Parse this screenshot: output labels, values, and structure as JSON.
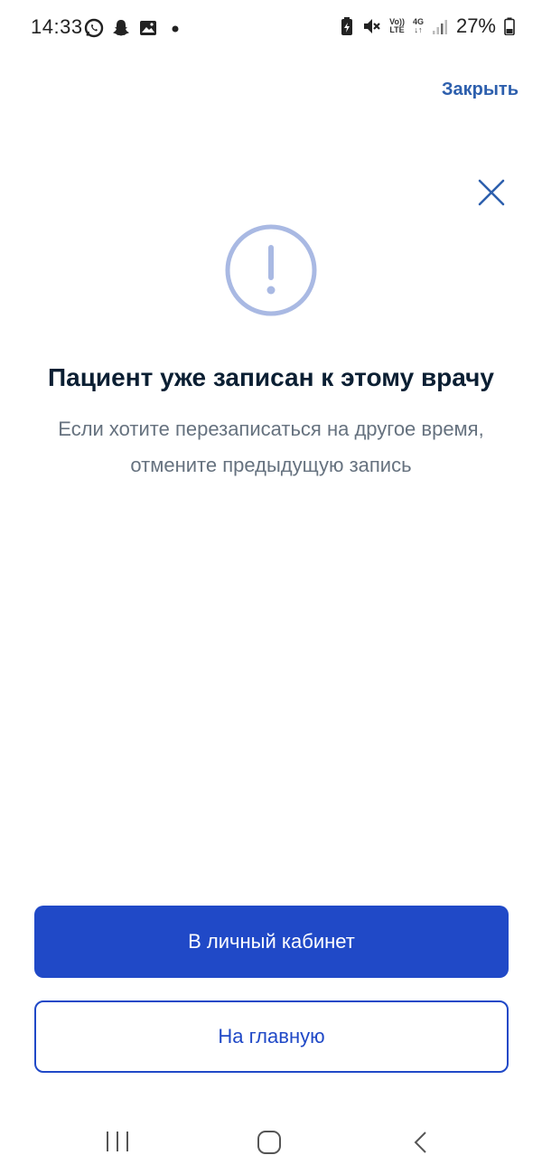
{
  "status_bar": {
    "time": "14:33",
    "battery_percent": "27%",
    "net_top": "Vo))",
    "net_bottom": "LTE",
    "gen_top": "4G",
    "gen_bottom": "↓↑",
    "icons": [
      "whatsapp-icon",
      "snapchat-icon",
      "gallery-icon",
      "dot-icon",
      "battery-saver-icon",
      "mute-icon",
      "signal-icon",
      "battery-icon"
    ]
  },
  "header": {
    "close_label": "Закрыть"
  },
  "dialog": {
    "icon": "alert-circle-icon",
    "title": "Пациент уже записан к этому врачу",
    "subtitle": "Если хотите перезаписаться на другое время, отмените предыдущую запись"
  },
  "actions": {
    "primary_label": "В личный кабинет",
    "secondary_label": "На главную"
  },
  "colors": {
    "accent": "#2049c7",
    "link": "#2d5fad",
    "alert_icon": "#a9b9e3",
    "title": "#0b1f33",
    "subtitle": "#66727f"
  },
  "nav": {
    "icons": [
      "recents-icon",
      "home-icon",
      "back-icon"
    ]
  }
}
